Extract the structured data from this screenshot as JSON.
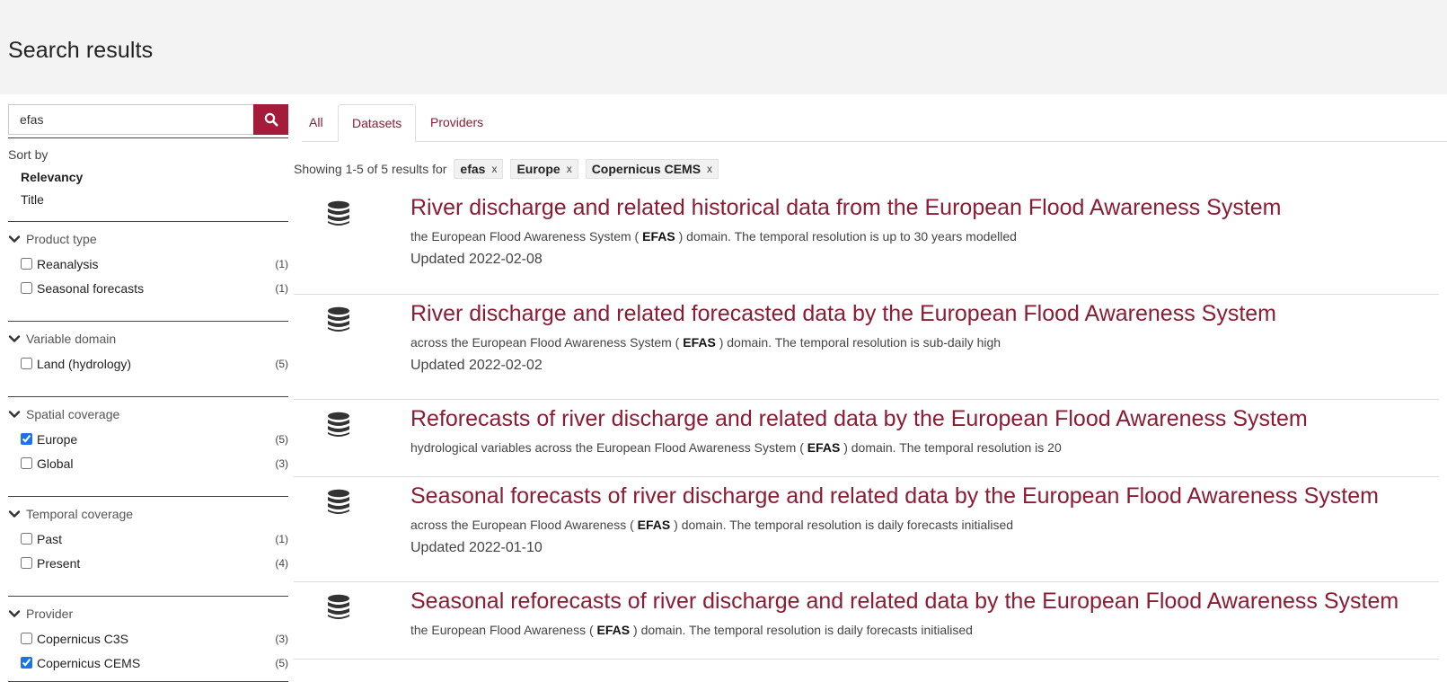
{
  "header": {
    "title": "Search results"
  },
  "search": {
    "value": "efas",
    "button_icon": "search-icon"
  },
  "sort": {
    "label": "Sort by",
    "options": [
      "Relevancy",
      "Title"
    ],
    "active": "Relevancy"
  },
  "facets": [
    {
      "title": "Product type",
      "items": [
        {
          "label": "Reanalysis",
          "count": "(1)",
          "checked": false
        },
        {
          "label": "Seasonal forecasts",
          "count": "(1)",
          "checked": false
        }
      ]
    },
    {
      "title": "Variable domain",
      "items": [
        {
          "label": "Land (hydrology)",
          "count": "(5)",
          "checked": false
        }
      ]
    },
    {
      "title": "Spatial coverage",
      "items": [
        {
          "label": "Europe",
          "count": "(5)",
          "checked": true
        },
        {
          "label": "Global",
          "count": "(3)",
          "checked": false
        }
      ]
    },
    {
      "title": "Temporal coverage",
      "items": [
        {
          "label": "Past",
          "count": "(1)",
          "checked": false
        },
        {
          "label": "Present",
          "count": "(4)",
          "checked": false
        }
      ]
    },
    {
      "title": "Provider",
      "items": [
        {
          "label": "Copernicus C3S",
          "count": "(3)",
          "checked": false
        },
        {
          "label": "Copernicus CEMS",
          "count": "(5)",
          "checked": true
        }
      ]
    }
  ],
  "tabs": [
    {
      "label": "All",
      "active": false
    },
    {
      "label": "Datasets",
      "active": true
    },
    {
      "label": "Providers",
      "active": false
    }
  ],
  "showing": {
    "text": "Showing 1-5 of 5 results for",
    "chips": [
      "efas",
      "Europe",
      "Copernicus CEMS"
    ],
    "chip_remove": "x"
  },
  "results": [
    {
      "title": "River discharge and related historical data from the European Flood Awareness System",
      "desc_before": "the European Flood Awareness System ( ",
      "desc_highlight": "EFAS",
      "desc_after": " ) domain. The temporal resolution is up to 30 years modelled",
      "date": "Updated 2022-02-08"
    },
    {
      "title": "River discharge and related forecasted data by the European Flood Awareness System",
      "desc_before": "across the European Flood Awareness System ( ",
      "desc_highlight": "EFAS",
      "desc_after": " ) domain. The temporal resolution is sub-daily high",
      "date": "Updated 2022-02-02"
    },
    {
      "title": "Reforecasts of river discharge and related data by the European Flood Awareness System",
      "desc_before": "hydrological variables across the European Flood Awareness System ( ",
      "desc_highlight": "EFAS",
      "desc_after": " ) domain. The temporal resolution is 20",
      "date": ""
    },
    {
      "title": "Seasonal forecasts of river discharge and related data by the European Flood Awareness System",
      "desc_before": "across the European Flood Awareness ( ",
      "desc_highlight": "EFAS",
      "desc_after": " ) domain. The temporal resolution is daily forecasts initialised",
      "date": "Updated 2022-01-10"
    },
    {
      "title": "Seasonal reforecasts of river discharge and related data by the European Flood Awareness System",
      "desc_before": "the European Flood Awareness ( ",
      "desc_highlight": "EFAS",
      "desc_after": " ) domain. The temporal resolution is daily forecasts initialised",
      "date": ""
    }
  ],
  "colors": {
    "accent": "#a51b3a",
    "link": "#8b1c33",
    "header_bg": "#f3f3f3"
  }
}
